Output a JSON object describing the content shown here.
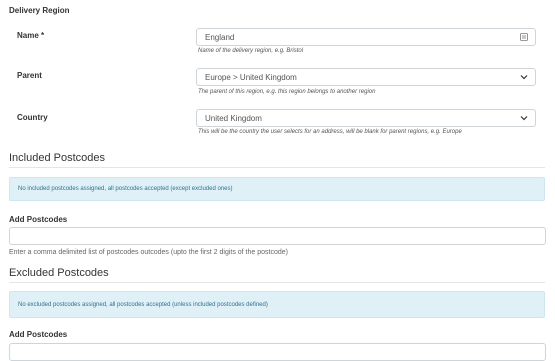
{
  "section_title": "Delivery Region",
  "name_field": {
    "label": "Name *",
    "value": "England",
    "help": "Name of the delivery region, e.g. Bristol"
  },
  "parent_field": {
    "label": "Parent",
    "value": "Europe > United Kingdom",
    "help": "The parent of this region, e.g. this region belongs to another region"
  },
  "country_field": {
    "label": "Country",
    "value": "United Kingdom",
    "help": "This will be the country the user selects for an address, will be blank for parent regions, e.g. Europe"
  },
  "included": {
    "heading": "Included Postcodes",
    "alert": "No included postcodes assigned, all postcodes accepted (except excluded ones)",
    "add_label": "Add Postcodes",
    "add_value": "",
    "hint": "Enter a comma delimited list of postcodes outcodes (upto the first 2 digits of the postcode)"
  },
  "excluded": {
    "heading": "Excluded Postcodes",
    "alert": "No excluded postcodes assigned, all postcodes accepted (unless included postcodes defined)",
    "add_label": "Add Postcodes"
  },
  "icons": {
    "name_field_icon": "keyboard-icon",
    "select_icon": "chevron-down-icon"
  }
}
